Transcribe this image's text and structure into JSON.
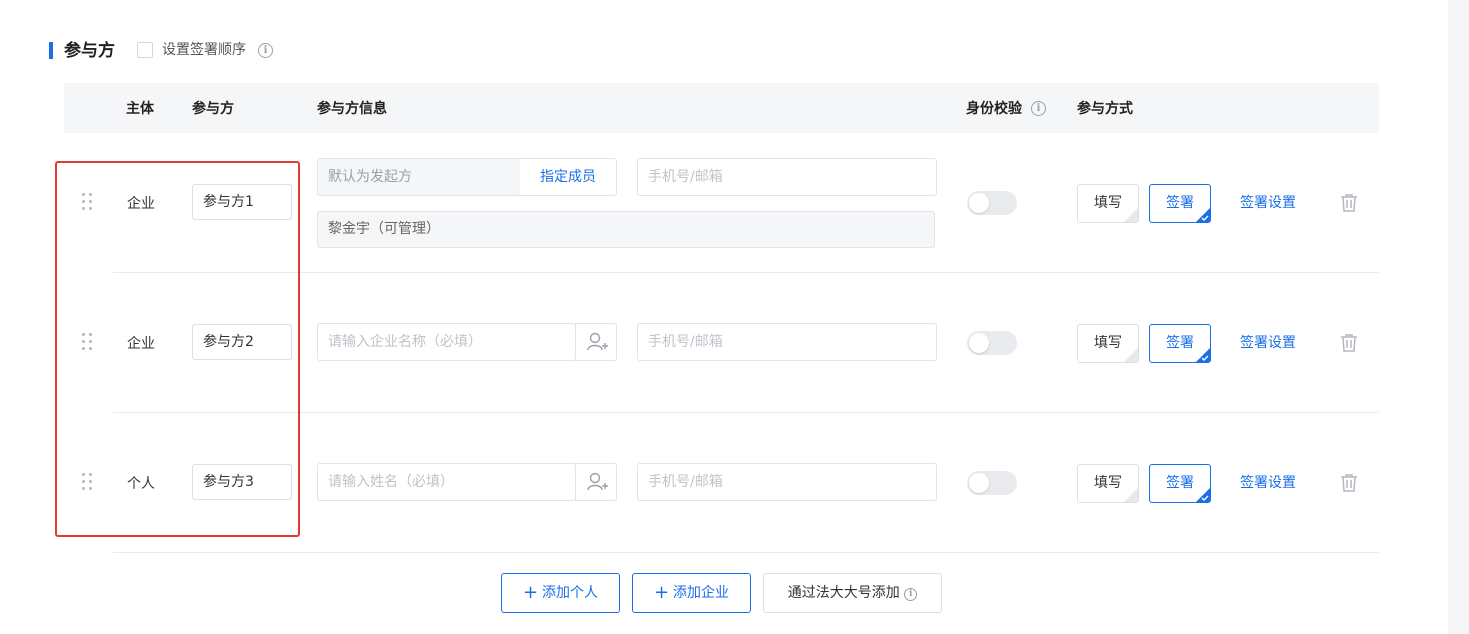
{
  "section": {
    "title": "参与方",
    "order_label": "设置签署顺序"
  },
  "table": {
    "headers": {
      "subject": "主体",
      "party": "参与方",
      "info": "参与方信息",
      "verify": "身份校验",
      "mode": "参与方式"
    }
  },
  "rows": [
    {
      "subject": "企业",
      "party": "参与方1",
      "company_field": "默认为发起方",
      "assign_label": "指定成员",
      "contact_placeholder": "手机号/邮箱",
      "member_field": "黎金宇（可管理）",
      "fill_label": "填写",
      "sign_label": "签署",
      "settings_label": "签署设置"
    },
    {
      "subject": "企业",
      "party": "参与方2",
      "name_placeholder": "请输入企业名称（必填）",
      "contact_placeholder": "手机号/邮箱",
      "fill_label": "填写",
      "sign_label": "签署",
      "settings_label": "签署设置"
    },
    {
      "subject": "个人",
      "party": "参与方3",
      "name_placeholder": "请输入姓名（必填）",
      "contact_placeholder": "手机号/邮箱",
      "fill_label": "填写",
      "sign_label": "签署",
      "settings_label": "签署设置"
    }
  ],
  "actions": {
    "add_person": "添加个人",
    "add_company": "添加企业",
    "add_via_account": "通过法大大号添加"
  },
  "icons": {
    "info": "info-icon",
    "drag": "drag-handle-icon",
    "add_contact": "add-person-icon",
    "trash": "trash-icon",
    "tick": "checkmark-icon"
  },
  "colors": {
    "accent": "#1a6fe8",
    "highlight": "#e53935"
  }
}
